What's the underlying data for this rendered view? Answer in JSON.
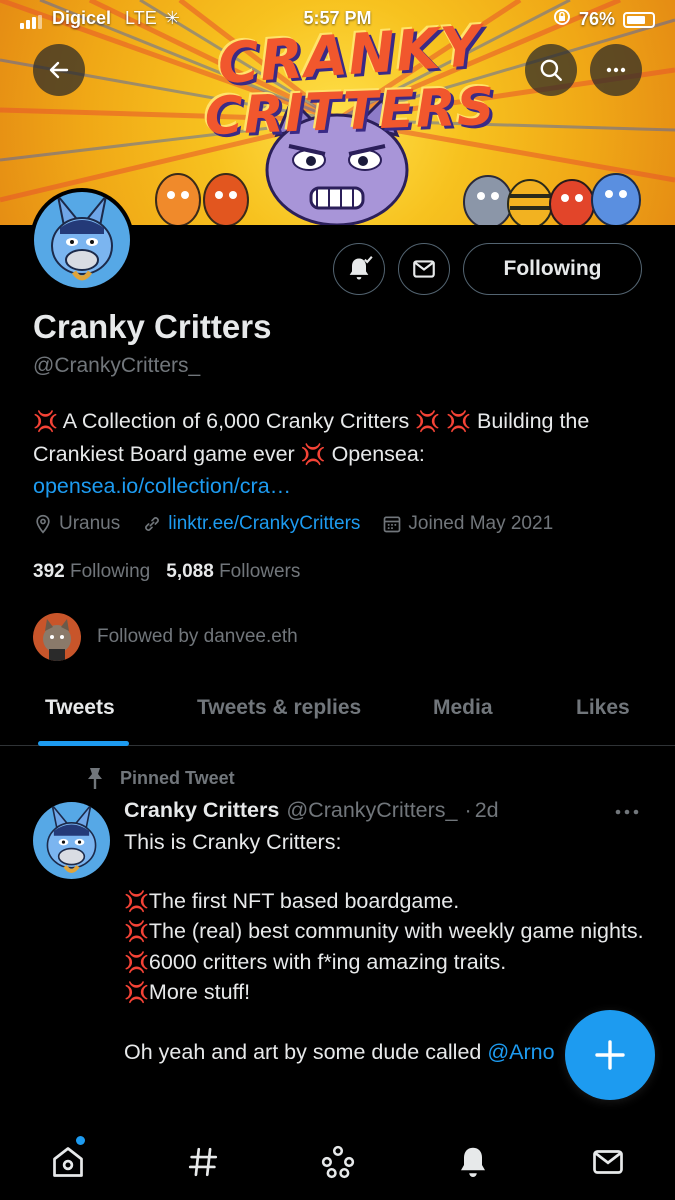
{
  "status_bar": {
    "carrier": "Digicel",
    "network": "LTE",
    "time": "5:57 PM",
    "battery": "76%",
    "battery_level": 0.76
  },
  "banner": {
    "title_line1": "CRANKY",
    "title_line2": "CRITTERS"
  },
  "header": {
    "back_icon": "arrow-left-icon",
    "search_icon": "search-icon",
    "more_icon": "more-horizontal-icon"
  },
  "profile": {
    "display_name": "Cranky Critters",
    "handle": "@CrankyCritters_",
    "bio_emoji": "💢",
    "bio_part1": " A Collection of 6,000 Cranky Critters ",
    "bio_part2": " Building the Crankiest Board game ever ",
    "bio_part3": " Opensea: ",
    "bio_link": "opensea.io/collection/cra…",
    "location": "Uranus",
    "website": "linktr.ee/CrankyCritters",
    "joined": "Joined May 2021",
    "following_count": "392",
    "following_label": "Following",
    "followers_count": "5,088",
    "followers_label": "Followers",
    "followed_by": "Followed by danvee.eth",
    "follow_button": "Following"
  },
  "tabs": [
    "Tweets",
    "Tweets & replies",
    "Media",
    "Likes"
  ],
  "active_tab": "Tweets",
  "pinned_tweet": {
    "pinned_label": "Pinned Tweet",
    "author_name": "Cranky Critters",
    "author_handle": "@CrankyCritters_",
    "separator": "·",
    "age": "2d",
    "line1": "This is Cranky Critters:",
    "bullet1": "The first NFT based boardgame.",
    "bullet2": "The (real) best community with weekly game nights.",
    "bullet3": "6000 critters with f*ing amazing traits.",
    "bullet4": "More stuff!",
    "closing": "Oh yeah and art by some dude called ",
    "closing_mention": "@Arno"
  },
  "colors": {
    "accent": "#1d9bf0",
    "muted": "#71767b",
    "text": "#e7e9ea",
    "border": "#2f3336",
    "angry": "#e0245e"
  },
  "bottom_nav": [
    "home-icon",
    "explore-hashtag-icon",
    "spaces-icon",
    "notifications-bell-icon",
    "messages-mail-icon"
  ]
}
